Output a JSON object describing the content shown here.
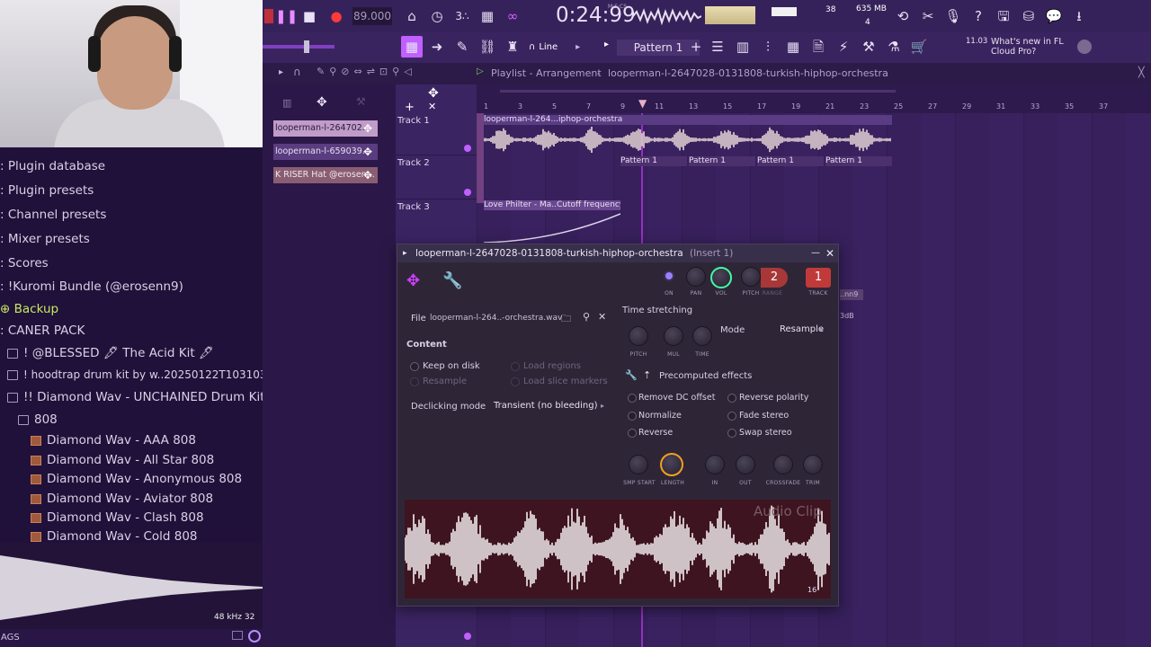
{
  "sidebar": {
    "items": [
      {
        "label": "Plugin database",
        "prefix": ":"
      },
      {
        "label": "Plugin presets",
        "prefix": ":"
      },
      {
        "label": "Channel presets",
        "prefix": ":"
      },
      {
        "label": "Mixer presets",
        "prefix": ":"
      },
      {
        "label": "Scores",
        "prefix": ":"
      },
      {
        "label": "!Kuromi Bundle (@erosenn9)",
        "prefix": ":"
      },
      {
        "label": "Backup",
        "prefix": "⊕"
      },
      {
        "label": "CANER PACK",
        "prefix": ":"
      },
      {
        "label": "! @BLESSED 🖋 The Acid Kit 🖋",
        "prefix": ""
      },
      {
        "label": "! hoodtrap drum kit by w..20250122T103103Z-001",
        "prefix": ""
      },
      {
        "label": "!! Diamond Wav - UNCHAINED Drum Kit",
        "prefix": ""
      },
      {
        "label": "808",
        "prefix": ""
      },
      {
        "label": "Diamond Wav - AAA 808",
        "prefix": ""
      },
      {
        "label": "Diamond Wav - All Star 808",
        "prefix": ""
      },
      {
        "label": "Diamond Wav - Anonymous 808",
        "prefix": ""
      },
      {
        "label": "Diamond Wav - Aviator 808",
        "prefix": ""
      },
      {
        "label": "Diamond Wav - Clash 808",
        "prefix": ""
      },
      {
        "label": "Diamond Wav - Cold 808",
        "prefix": ""
      }
    ],
    "bottom_left": "AGS",
    "samplerate": "48 kHz 32"
  },
  "topbar": {
    "tempo": "89.000",
    "time": "0:24:99",
    "time_label": "M:S:CS",
    "cpu": "38",
    "memory": "635 MB",
    "poly": "4",
    "news_time": "11.03",
    "news_text": "What's new in FL Cloud Pro?"
  },
  "toolbar2": {
    "snap": "Line",
    "pattern": "Pattern 1"
  },
  "playlist": {
    "title": "Playlist - Arrangement",
    "project": "looperman-l-2647028-0131808-turkish-hiphop-orchestra",
    "picker": [
      "looperman-l-264702...",
      "looperman-l-659039...",
      "K RISER Hat @erosen..."
    ],
    "tracks": [
      "Track 1",
      "Track 2",
      "Track 3"
    ],
    "ruler": [
      "1",
      "3",
      "5",
      "7",
      "9",
      "11",
      "13",
      "15",
      "17",
      "19",
      "21",
      "23",
      "25",
      "27",
      "29",
      "31",
      "33",
      "35",
      "37"
    ],
    "clip_audio": "looperman-l-264...iphop-orchestra",
    "clip_pattern": "Pattern 1",
    "clip_auto": "Love Philter - Ma..Cutoff frequency",
    "side_label_1": "..nn9",
    "side_label_2": "3dB"
  },
  "dialog": {
    "title": "looperman-l-2647028-0131808-turkish-hiphop-orchestra",
    "insert": "(Insert 1)",
    "file_label": "File",
    "file_value": "looperman-l-264..-orchestra.wav",
    "content_heading": "Content",
    "keep_on_disk": "Keep on disk",
    "load_regions": "Load regions",
    "resample": "Resample",
    "load_slice_markers": "Load slice markers",
    "declicking_label": "Declicking mode",
    "declicking_value": "Transient (no bleeding)",
    "knob_labels": {
      "on": "ON",
      "pan": "PAN",
      "vol": "VOL",
      "pitch": "PITCH",
      "range": "RANGE",
      "track": "TRACK"
    },
    "pitch_range": "2",
    "track_num": "1",
    "time_stretching": "Time stretching",
    "mode_label": "Mode",
    "mode_value": "Resample",
    "ts_knobs": [
      "PITCH",
      "MUL",
      "TIME"
    ],
    "precomputed": "Precomputed effects",
    "effects": [
      "Remove DC offset",
      "Reverse polarity",
      "Normalize",
      "Fade stereo",
      "Reverse",
      "Swap stereo"
    ],
    "bottom_knobs": [
      "SMP START",
      "LENGTH",
      "IN",
      "OUT",
      "CROSSFADE",
      "TRIM"
    ],
    "wave_label": "Audio Clip",
    "wave_num": "16"
  },
  "colors": {
    "accent": "#e040ff",
    "purple_bg": "#2a1646",
    "dialog_bg": "#2e2637",
    "red": "#c0303a"
  }
}
